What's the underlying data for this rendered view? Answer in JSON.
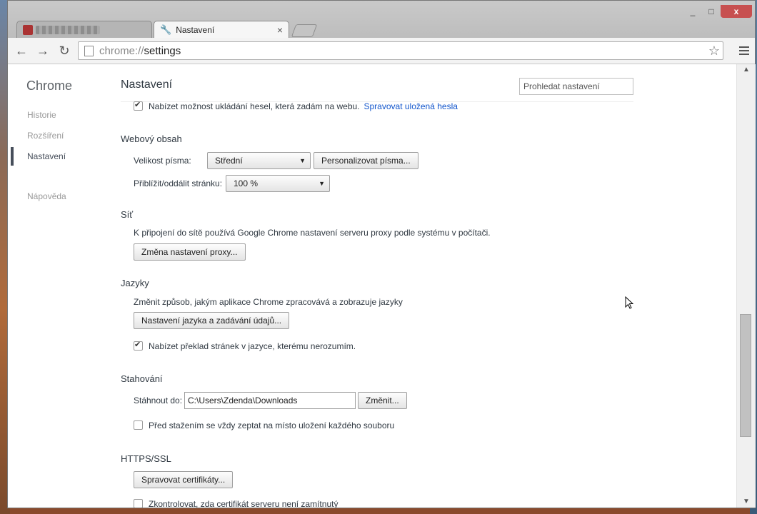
{
  "tabs": {
    "active_title": "Nastavení",
    "close_glyph": "×"
  },
  "window_controls": {
    "minimize": "_",
    "maximize": "□",
    "close": "x"
  },
  "toolbar": {
    "back": "←",
    "forward": "→",
    "reload": "↻",
    "url_scheme": "chrome://",
    "url_host": "settings",
    "star": "☆"
  },
  "sidebar": {
    "brand": "Chrome",
    "items": [
      {
        "label": "Historie"
      },
      {
        "label": "Rozšíření"
      },
      {
        "label": "Nastavení"
      },
      {
        "label": "Nápověda"
      }
    ]
  },
  "header": {
    "title": "Nastavení",
    "search_placeholder": "Prohledat nastavení"
  },
  "passwords": {
    "offer_save": "Nabízet možnost ukládání hesel, která zadám na webu.",
    "manage_link": "Spravovat uložená hesla",
    "checked": true
  },
  "web_content": {
    "heading": "Webový obsah",
    "font_size_label": "Velikost písma:",
    "font_size_value": "Střední",
    "customize_fonts": "Personalizovat písma...",
    "zoom_label": "Přiblížit/oddálit stránku:",
    "zoom_value": "100 %"
  },
  "network": {
    "heading": "Síť",
    "description": "K připojení do sítě používá Google Chrome nastavení serveru proxy podle systému v počítači.",
    "change_proxy": "Změna nastavení proxy..."
  },
  "languages": {
    "heading": "Jazyky",
    "description": "Změnit způsob, jakým aplikace Chrome zpracovává a zobrazuje jazyky",
    "settings_button": "Nastavení jazyka a zadávání údajů...",
    "offer_translate": "Nabízet překlad stránek v jazyce, kterému nerozumím.",
    "translate_checked": true
  },
  "downloads": {
    "heading": "Stahování",
    "location_label": "Stáhnout do:",
    "location_value": "C:\\Users\\Zdenda\\Downloads",
    "change_button": "Změnit...",
    "ask_each": "Před stažením se vždy zeptat na místo uložení každého souboru",
    "ask_checked": false
  },
  "https": {
    "heading": "HTTPS/SSL",
    "manage_certs": "Spravovat certifikáty...",
    "check_revocation": "Zkontrolovat, zda certifikát serveru není zamítnutý"
  },
  "scrollbar": {
    "up": "▲",
    "down": "▼",
    "position_fraction": 0.72
  }
}
